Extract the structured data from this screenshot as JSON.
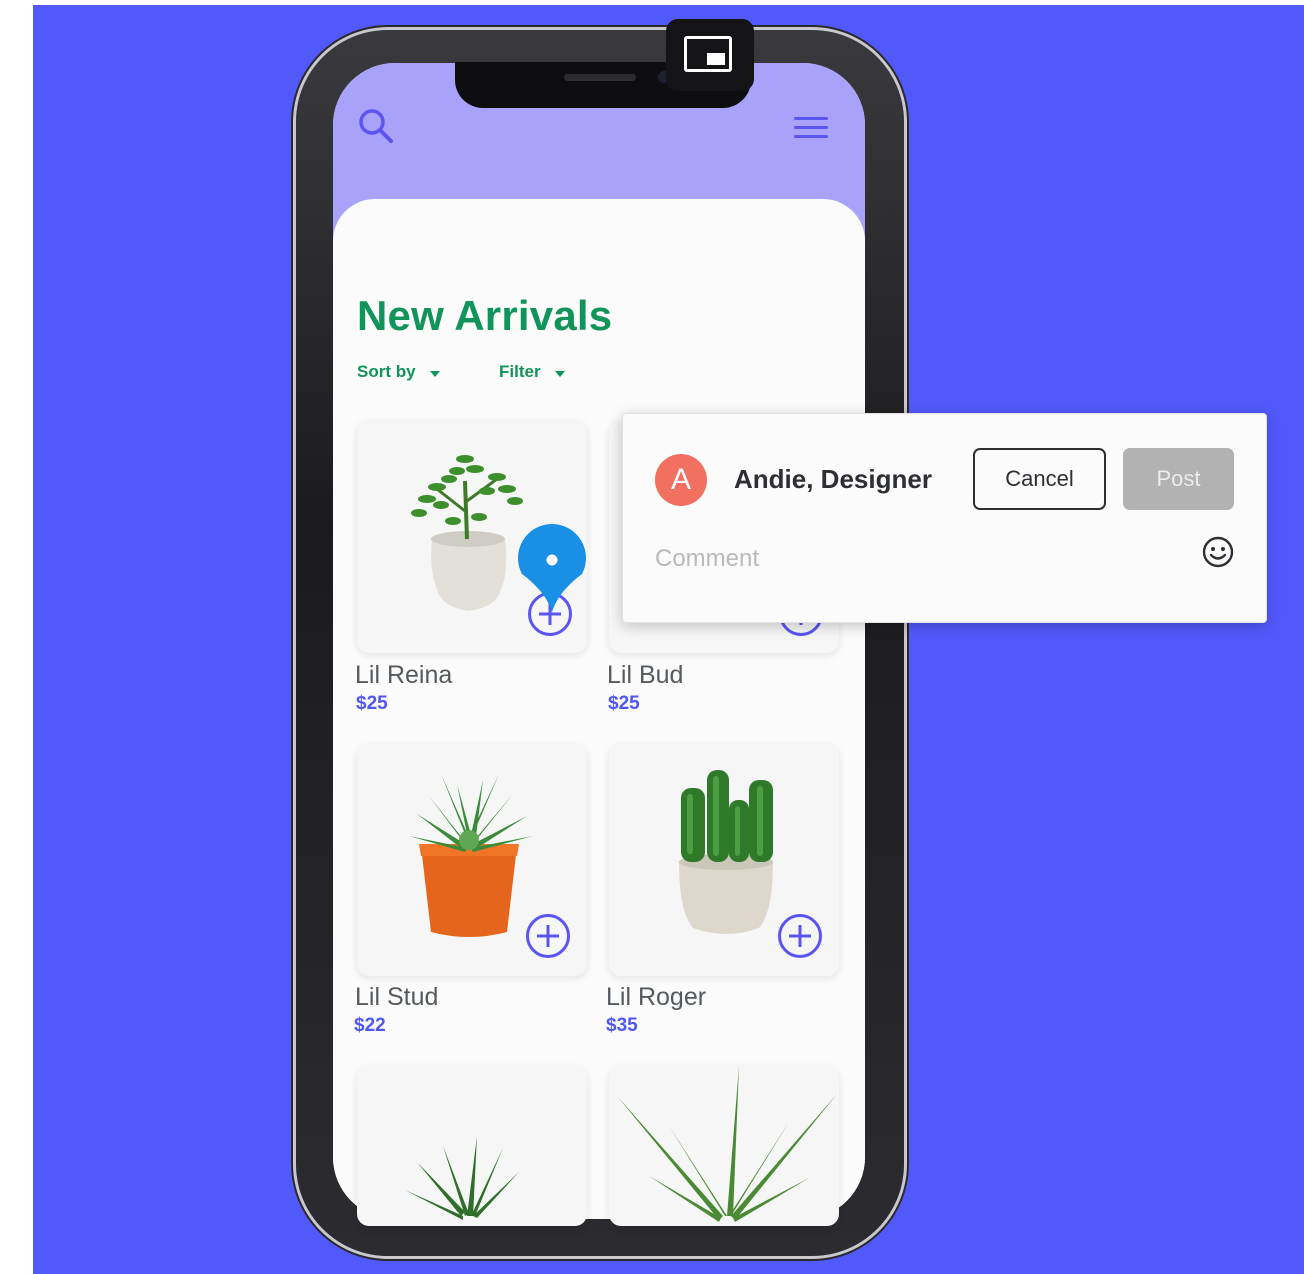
{
  "app": {
    "title": "New Arrivals",
    "sort_label": "Sort by",
    "filter_label": "Filter"
  },
  "icons": {
    "search": "search-icon",
    "menu": "hamburger-menu-icon",
    "add": "plus-circle-icon",
    "pin": "map-pin-icon",
    "emoji": "smiley-icon",
    "pip": "picture-in-picture-icon"
  },
  "products": [
    {
      "name": "Lil Reina",
      "price": "$25"
    },
    {
      "name": "Lil Bud",
      "price": "$25"
    },
    {
      "name": "Lil Stud",
      "price": "$22"
    },
    {
      "name": "Lil Roger",
      "price": "$35"
    }
  ],
  "comment": {
    "avatar_initial": "A",
    "author": "Andie, Designer",
    "cancel_label": "Cancel",
    "post_label": "Post",
    "placeholder": "Comment"
  },
  "colors": {
    "background": "#5159fb",
    "title_green": "#11945a",
    "price_blue": "#4f56f2",
    "header_purple": "#a9a2fa",
    "avatar": "#f2705f",
    "pin_blue": "#1a8fe6"
  }
}
